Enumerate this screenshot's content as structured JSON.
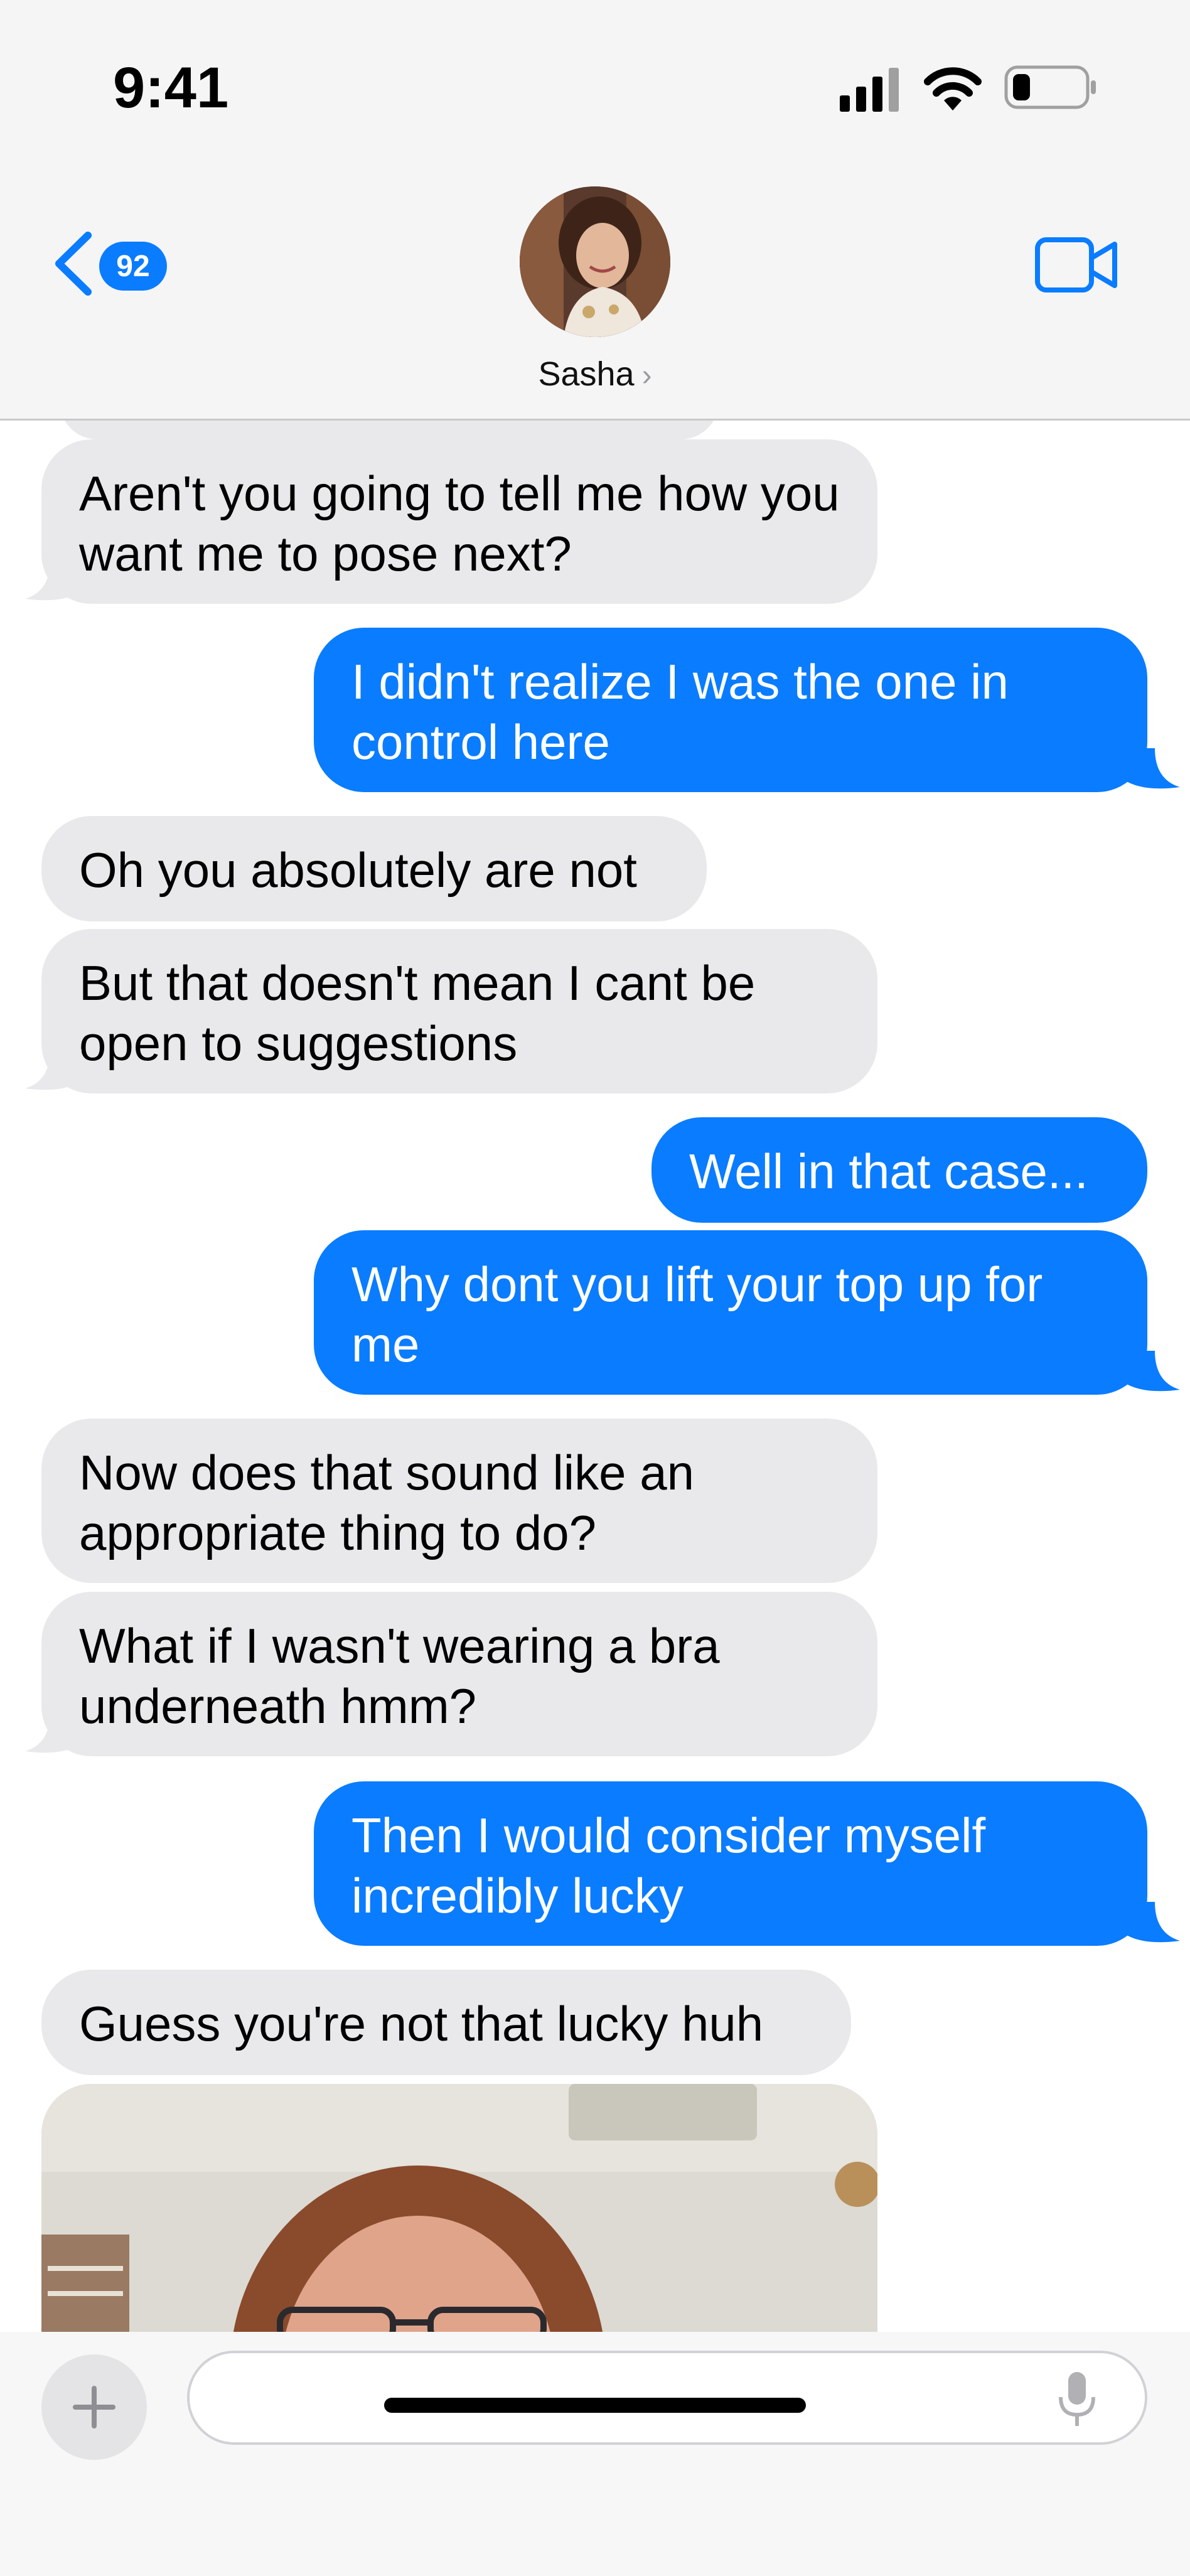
{
  "status_bar": {
    "time": "9:41",
    "battery_level": 0.25
  },
  "nav": {
    "back_badge_count": "92",
    "contact_name": "Sasha",
    "contact_chevron": "›"
  },
  "icons": {
    "back": "chevron-left-icon",
    "video": "video-camera-icon",
    "add": "plus-icon",
    "mic": "microphone-icon"
  },
  "colors": {
    "outgoing": "#0a7cff",
    "incoming": "#e9e9eb",
    "badge": "#0a7cff"
  },
  "messages": [
    {
      "from": "contact",
      "text": "Aren't you going to tell me how you want me to pose next?"
    },
    {
      "from": "me",
      "text": "I didn't realize I was the one in control here"
    },
    {
      "from": "contact",
      "text": "Oh you absolutely are not"
    },
    {
      "from": "contact",
      "text": "But that doesn't mean I cant be open to suggestions"
    },
    {
      "from": "me",
      "text": "Well in that case..."
    },
    {
      "from": "me",
      "text": "Why dont you lift your top up for me"
    },
    {
      "from": "contact",
      "text": "Now does that sound like an appropriate thing to do?"
    },
    {
      "from": "contact",
      "text": "What if I wasn't wearing a bra underneath hmm?"
    },
    {
      "from": "me",
      "text": "Then I would consider myself incredibly lucky"
    },
    {
      "from": "contact",
      "text": "Guess you're not that lucky huh"
    }
  ],
  "composer": {
    "value": "",
    "placeholder": ""
  }
}
